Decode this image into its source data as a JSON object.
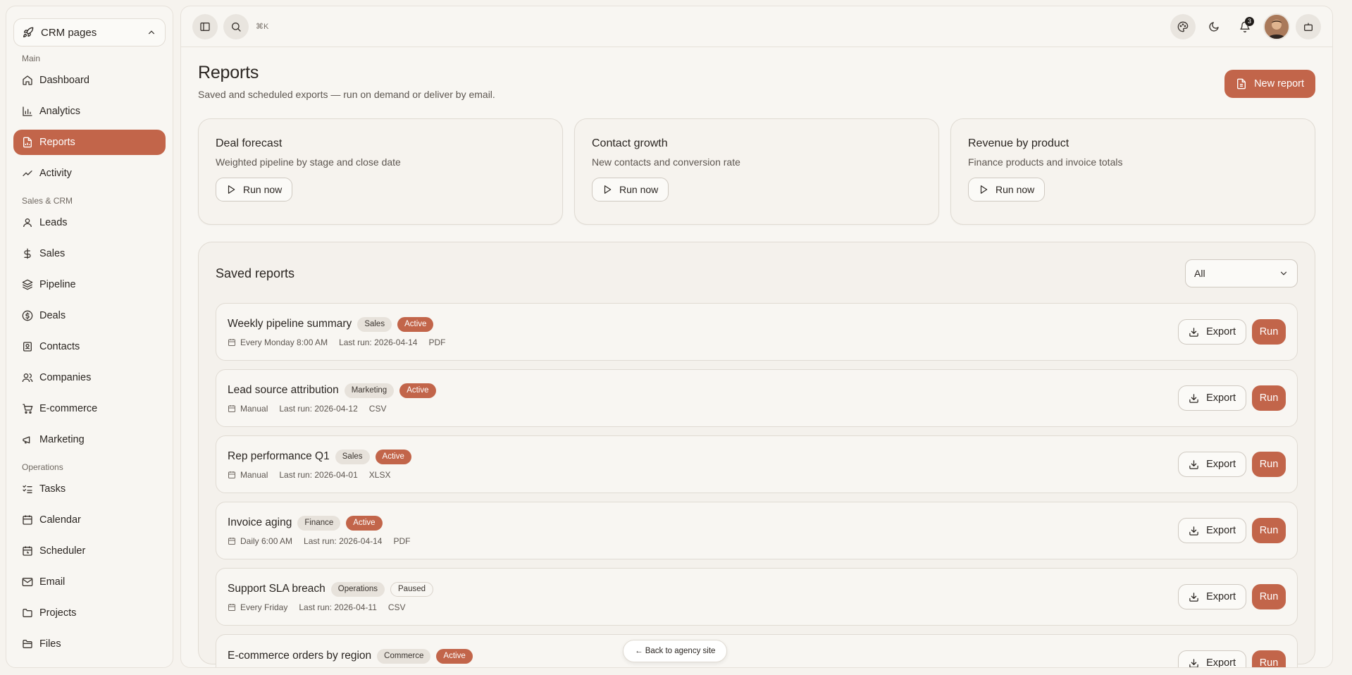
{
  "sidebar": {
    "switcher": {
      "label": "CRM pages",
      "icon": "rocket-icon"
    },
    "sections": [
      {
        "title": "Main",
        "items": [
          {
            "label": "Dashboard",
            "icon": "home-icon",
            "active": false
          },
          {
            "label": "Analytics",
            "icon": "bar-chart-icon",
            "active": false
          },
          {
            "label": "Reports",
            "icon": "file-chart-icon",
            "active": true
          },
          {
            "label": "Activity",
            "icon": "activity-icon",
            "active": false
          }
        ]
      },
      {
        "title": "Sales & CRM",
        "items": [
          {
            "label": "Leads",
            "icon": "user-icon",
            "active": false
          },
          {
            "label": "Sales",
            "icon": "dollar-icon",
            "active": false
          },
          {
            "label": "Pipeline",
            "icon": "layers-icon",
            "active": false
          },
          {
            "label": "Deals",
            "icon": "dollar-circle-icon",
            "active": false
          },
          {
            "label": "Contacts",
            "icon": "contact-book-icon",
            "active": false
          },
          {
            "label": "Companies",
            "icon": "users-icon",
            "active": false
          },
          {
            "label": "E-commerce",
            "icon": "cart-icon",
            "active": false
          },
          {
            "label": "Marketing",
            "icon": "megaphone-icon",
            "active": false
          }
        ]
      },
      {
        "title": "Operations",
        "items": [
          {
            "label": "Tasks",
            "icon": "list-check-icon",
            "active": false
          },
          {
            "label": "Calendar",
            "icon": "calendar-icon",
            "active": false
          },
          {
            "label": "Scheduler",
            "icon": "calendar-clock-icon",
            "active": false
          },
          {
            "label": "Email",
            "icon": "mail-icon",
            "active": false
          },
          {
            "label": "Projects",
            "icon": "folder-icon",
            "active": false
          },
          {
            "label": "Files",
            "icon": "folder-open-icon",
            "active": false
          }
        ]
      }
    ]
  },
  "topbar": {
    "shortcut": "⌘K",
    "notifications_count": "3"
  },
  "header": {
    "title": "Reports",
    "subtitle": "Saved and scheduled exports — run on demand or deliver by email.",
    "new_button": "New report"
  },
  "quick_cards": [
    {
      "title": "Deal forecast",
      "desc": "Weighted pipeline by stage and close date",
      "button": "Run now"
    },
    {
      "title": "Contact growth",
      "desc": "New contacts and conversion rate",
      "button": "Run now"
    },
    {
      "title": "Revenue by product",
      "desc": "Finance products and invoice totals",
      "button": "Run now"
    }
  ],
  "saved_reports": {
    "title": "Saved reports",
    "filter_value": "All",
    "export_label": "Export",
    "run_label": "Run",
    "rows": [
      {
        "name": "Weekly pipeline summary",
        "category": "Sales",
        "status": "Active",
        "schedule": "Every Monday 8:00 AM",
        "last_run": "Last run: 2026-04-14",
        "format": "PDF"
      },
      {
        "name": "Lead source attribution",
        "category": "Marketing",
        "status": "Active",
        "schedule": "Manual",
        "last_run": "Last run: 2026-04-12",
        "format": "CSV"
      },
      {
        "name": "Rep performance Q1",
        "category": "Sales",
        "status": "Active",
        "schedule": "Manual",
        "last_run": "Last run: 2026-04-01",
        "format": "XLSX"
      },
      {
        "name": "Invoice aging",
        "category": "Finance",
        "status": "Active",
        "schedule": "Daily 6:00 AM",
        "last_run": "Last run: 2026-04-14",
        "format": "PDF"
      },
      {
        "name": "Support SLA breach",
        "category": "Operations",
        "status": "Paused",
        "schedule": "Every Friday",
        "last_run": "Last run: 2026-04-11",
        "format": "CSV"
      },
      {
        "name": "E-commerce orders by region",
        "category": "Commerce",
        "status": "Active",
        "schedule": "",
        "last_run": "",
        "format": ""
      }
    ]
  },
  "back_link": "← Back to agency site",
  "colors": {
    "accent": "#c2654a",
    "background": "#f6f3ee",
    "border": "#e0dbd3"
  }
}
